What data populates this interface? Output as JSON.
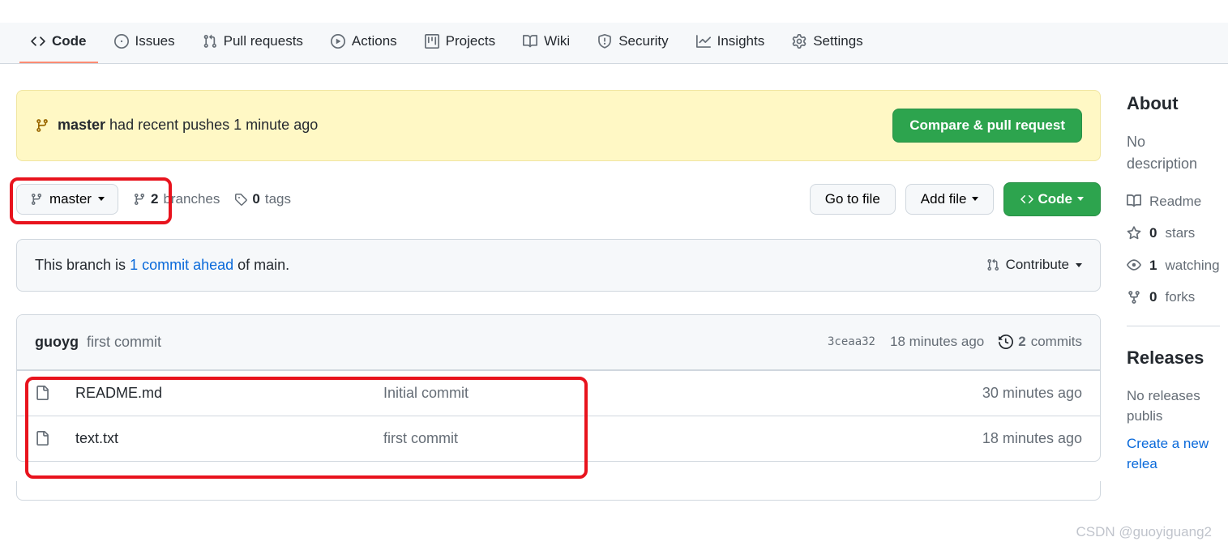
{
  "tabs": {
    "code": "Code",
    "issues": "Issues",
    "pull_requests": "Pull requests",
    "actions": "Actions",
    "projects": "Projects",
    "wiki": "Wiki",
    "security": "Security",
    "insights": "Insights",
    "settings": "Settings"
  },
  "flash": {
    "branch": "master",
    "text": " had recent pushes 1 minute ago",
    "button": "Compare & pull request"
  },
  "branch_select": "master",
  "branches": {
    "count": "2",
    "label": "branches"
  },
  "tags": {
    "count": "0",
    "label": "tags"
  },
  "buttons": {
    "goto_file": "Go to file",
    "add_file": "Add file",
    "code": "Code"
  },
  "branch_info": {
    "prefix": "This branch is",
    "link": "1 commit ahead",
    "suffix": " of main.",
    "contribute": "Contribute"
  },
  "latest_commit": {
    "author": "guoyg",
    "message": "first commit",
    "sha": "3ceaa32",
    "time": "18 minutes ago",
    "commits_count": "2",
    "commits_label": "commits"
  },
  "files": [
    {
      "name": "README.md",
      "message": "Initial commit",
      "time": "30 minutes ago"
    },
    {
      "name": "text.txt",
      "message": "first commit",
      "time": "18 minutes ago"
    }
  ],
  "about": {
    "title": "About",
    "description": "No description",
    "readme": "Readme",
    "stars_count": "0",
    "stars_label": "stars",
    "watching_count": "1",
    "watching_label": "watching",
    "forks_count": "0",
    "forks_label": "forks"
  },
  "releases": {
    "title": "Releases",
    "none_text": "No releases publis",
    "create_link": "Create a new relea"
  },
  "watermark": "CSDN @guoyiguang2"
}
